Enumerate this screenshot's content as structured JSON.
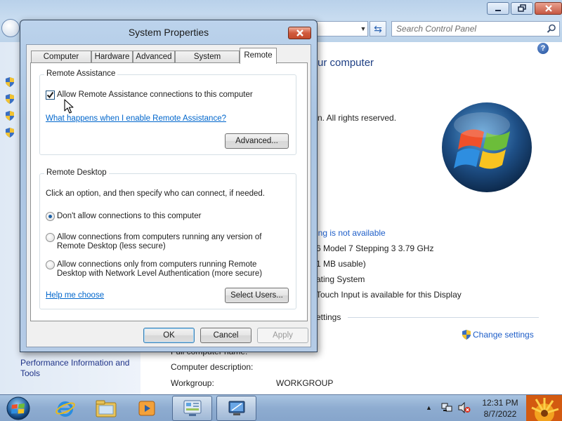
{
  "control_panel": {
    "search_placeholder": "Search Control Panel",
    "heading": "ur computer",
    "copyright": "n.  All rights reserved.",
    "see_also_link": "Performance Information and Tools",
    "info_rows": [
      {
        "text": "ing is not available",
        "is_link": true
      },
      {
        "text": "6 Model 7 Stepping 3   3.79 GHz",
        "is_link": false
      },
      {
        "text": "1 MB usable)",
        "is_link": false
      },
      {
        "text": "ating System",
        "is_link": false
      },
      {
        "text": "Touch Input is available for this Display",
        "is_link": false
      }
    ],
    "settings_heading": "ettings",
    "change_settings": "Change settings",
    "computer_name_label": "Full computer name:",
    "computer_desc_label": "Computer description:",
    "workgroup_label": "Workgroup:",
    "workgroup_value": "WORKGROUP"
  },
  "dialog": {
    "title": "System Properties",
    "tabs": [
      {
        "label": "Computer Name",
        "active": false
      },
      {
        "label": "Hardware",
        "active": false
      },
      {
        "label": "Advanced",
        "active": false
      },
      {
        "label": "System Protection",
        "active": false
      },
      {
        "label": "Remote",
        "active": true
      }
    ],
    "remote_assistance": {
      "title": "Remote Assistance",
      "checkbox_label": "Allow Remote Assistance connections to this computer",
      "checked": true,
      "help_link": "What happens when I enable Remote Assistance?",
      "advanced_button": "Advanced..."
    },
    "remote_desktop": {
      "title": "Remote Desktop",
      "instructions": "Click an option, and then specify who can connect, if needed.",
      "options": [
        {
          "line1": "Don't allow connections to this computer",
          "line2": "",
          "selected": true
        },
        {
          "line1": "Allow connections from computers running any version of",
          "line2": "Remote Desktop (less secure)",
          "selected": false
        },
        {
          "line1": "Allow connections only from computers running Remote",
          "line2": "Desktop with Network Level Authentication (more secure)",
          "selected": false
        }
      ],
      "help_link": "Help me choose",
      "select_users_button": "Select Users..."
    },
    "buttons": {
      "ok": "OK",
      "cancel": "Cancel",
      "apply": "Apply"
    }
  },
  "taskbar": {
    "time": "12:31 PM",
    "date": "8/7/2022",
    "pinned": [
      "explorer-icon",
      "internet-explorer-icon",
      "file-manager-icon",
      "media-player-icon",
      "control-panel-icon",
      "remote-desktop-icon"
    ]
  },
  "colors": {
    "link": "#0066cc",
    "cp_link": "#1e5ec8",
    "dialog_frame": "#a9c4e2",
    "close_red": "#c44a2c"
  }
}
